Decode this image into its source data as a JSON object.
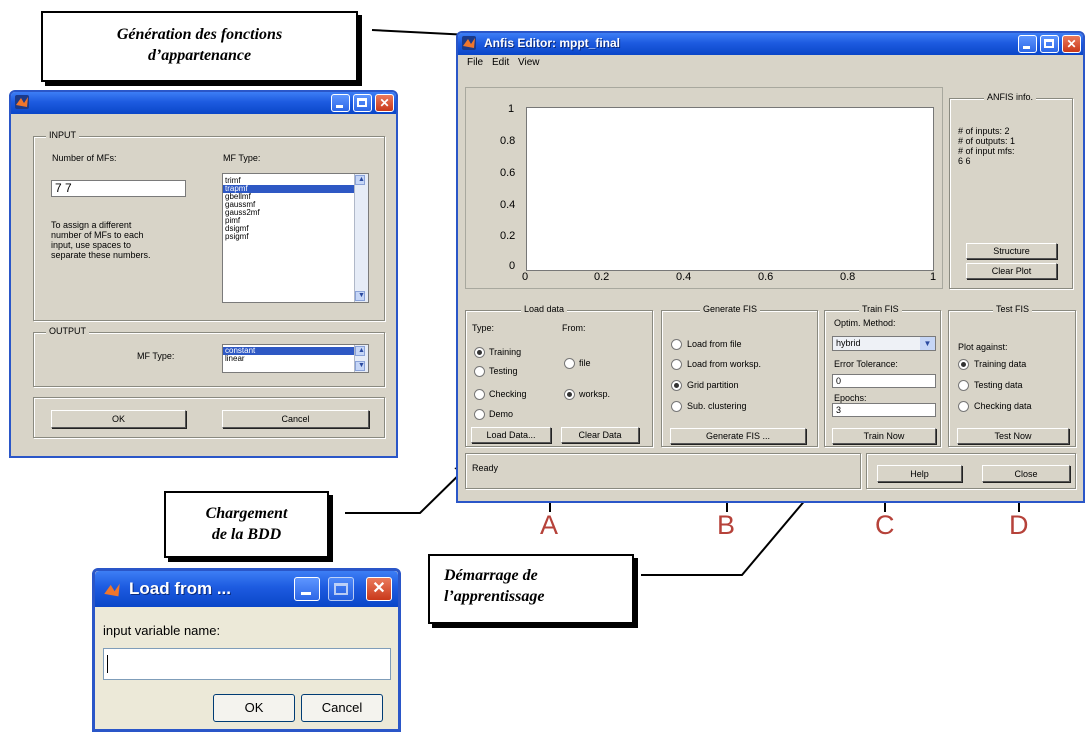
{
  "callouts": {
    "generation_line1": "Génération des fonctions",
    "generation_line2": "d’appartenance",
    "chargement_line1": "Chargement",
    "chargement_line2": "de la BDD",
    "demarrage_line1": "Démarrage de",
    "demarrage_line2": "l’apprentissage"
  },
  "section_letters": [
    "A",
    "B",
    "C",
    "D"
  ],
  "mf_dialog": {
    "input_group": "INPUT",
    "number_label": "Number of MFs:",
    "number_value": "7 7",
    "help_text": [
      "To assign a different",
      "number of MFs to each",
      "input, use spaces to",
      "separate these numbers."
    ],
    "mf_type_label": "MF Type:",
    "mf_types": [
      "trimf",
      "trapmf",
      "gbellmf",
      "gaussmf",
      "gauss2mf",
      "pimf",
      "dsigmf",
      "psigmf"
    ],
    "mf_type_selected_index": 1,
    "output_group": "OUTPUT",
    "output_type_label": "MF Type:",
    "output_types": [
      "constant",
      "linear"
    ],
    "output_selected_index": 0,
    "ok_label": "OK",
    "cancel_label": "Cancel"
  },
  "anfis": {
    "title": "Anfis Editor: mppt_final",
    "menu": [
      "File",
      "Edit",
      "View"
    ],
    "plot": {
      "x_ticks": [
        "0",
        "0.2",
        "0.4",
        "0.6",
        "0.8",
        "1"
      ],
      "y_ticks": [
        "1",
        "0.8",
        "0.6",
        "0.4",
        "0.2",
        "0"
      ]
    },
    "info": {
      "title": "ANFIS info.",
      "lines": [
        "# of inputs: 2",
        "# of outputs: 1",
        "# of input mfs:",
        "6  6"
      ],
      "structure_label": "Structure",
      "clear_plot_label": "Clear Plot"
    },
    "load_data": {
      "title": "Load data",
      "type_label": "Type:",
      "from_label": "From:",
      "types": [
        "Training",
        "Testing",
        "Checking",
        "Demo"
      ],
      "selected_type": 0,
      "sources": [
        "file",
        "worksp."
      ],
      "selected_source": 1,
      "load_button": "Load Data...",
      "clear_button": "Clear Data"
    },
    "generate_fis": {
      "title": "Generate FIS",
      "options": [
        "Load from file",
        "Load from worksp.",
        "Grid partition",
        "Sub. clustering"
      ],
      "selected": 2,
      "button": "Generate FIS ..."
    },
    "train_fis": {
      "title": "Train FIS",
      "method_label": "Optim. Method:",
      "method_value": "hybrid",
      "tolerance_label": "Error Tolerance:",
      "tolerance_value": "0",
      "epochs_label": "Epochs:",
      "epochs_value": "3",
      "button": "Train Now"
    },
    "test_fis": {
      "title": "Test FIS",
      "plot_against_label": "Plot against:",
      "options": [
        "Training data",
        "Testing data",
        "Checking data"
      ],
      "selected": 0,
      "button": "Test Now"
    },
    "status": "Ready",
    "help_label": "Help",
    "close_label": "Close"
  },
  "load_dialog": {
    "title": "Load from ...",
    "prompt": "input variable name:",
    "input_value": "",
    "ok_label": "OK",
    "cancel_label": "Cancel"
  },
  "colors": {
    "titlebar": "#1d5be0",
    "dialog_bg": "#d8d4c8",
    "selection": "#2e58c4",
    "letters": "#b6423a"
  }
}
